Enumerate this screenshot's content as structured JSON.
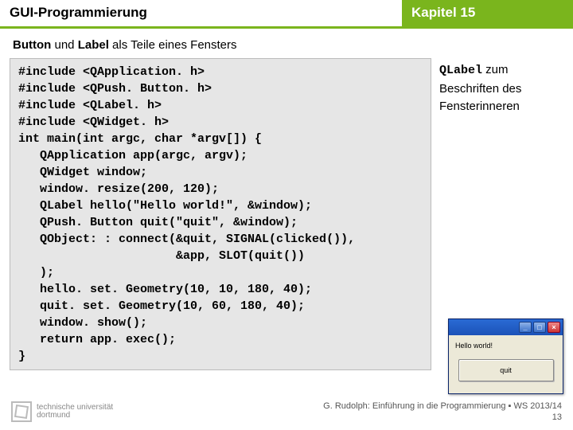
{
  "header": {
    "left": "GUI-Programmierung",
    "right": "Kapitel 15"
  },
  "subtitle_bold": "Button",
  "subtitle_mid": " und ",
  "subtitle_bold2": "Label",
  "subtitle_rest": " als Teile eines Fensters",
  "code": "#include <QApplication. h>\n#include <QPush. Button. h>\n#include <QLabel. h>\n#include <QWidget. h>\nint main(int argc, char *argv[]) {\n   QApplication app(argc, argv);\n   QWidget window;\n   window. resize(200, 120);\n   QLabel hello(\"Hello world!\", &window);\n   QPush. Button quit(\"quit\", &window);\n   QObject: : connect(&quit, SIGNAL(clicked()),\n                      &app, SLOT(quit())\n   );\n   hello. set. Geometry(10, 10, 180, 40);\n   quit. set. Geometry(10, 60, 180, 40);\n   window. show();\n   return app. exec();\n}",
  "note": {
    "mono": "QLabel",
    "after_mono": " zum",
    "line2": "Beschriften des",
    "line3": "Fensterinneren"
  },
  "mock": {
    "label": "Hello world!",
    "button": "quit"
  },
  "footer": {
    "uni_line1": "technische universität",
    "uni_line2": "dortmund",
    "credit": "G. Rudolph: Einführung in die Programmierung ▪ WS 2013/14",
    "page": "13"
  }
}
